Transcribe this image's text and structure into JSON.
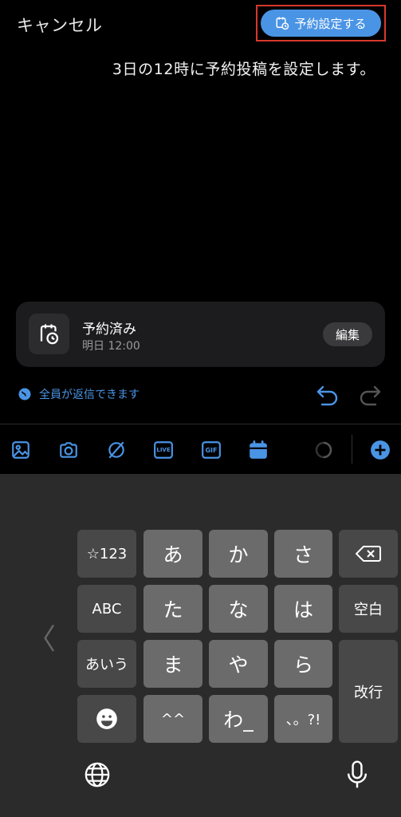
{
  "header": {
    "cancel_label": "キャンセル",
    "schedule_button_label": "予約設定する"
  },
  "notice": "3日の12時に予約投稿を設定します。",
  "scheduled_card": {
    "title": "予約済み",
    "time": "明日 12:00",
    "edit_label": "編集"
  },
  "reply_setting": "全員が返信できます",
  "toolbar": {
    "icons": [
      "image-icon",
      "camera-icon",
      "grok-icon",
      "live-icon",
      "gif-icon",
      "calendar-icon",
      "progress-circle-icon",
      "add-icon"
    ],
    "live_label": "LIVE",
    "gif_label": "GIF"
  },
  "keyboard": {
    "row1": [
      "☆123",
      "あ",
      "か",
      "さ"
    ],
    "row2": [
      "ABC",
      "た",
      "な",
      "は",
      "空白"
    ],
    "row3": [
      "あいう",
      "ま",
      "や",
      "ら"
    ],
    "row4": [
      "^^",
      "わ_",
      "、。?!"
    ],
    "enter_label": "改行",
    "left_chevron": "〈"
  },
  "colors": {
    "accent": "#4a94e5",
    "highlight_border": "#d7382b"
  }
}
